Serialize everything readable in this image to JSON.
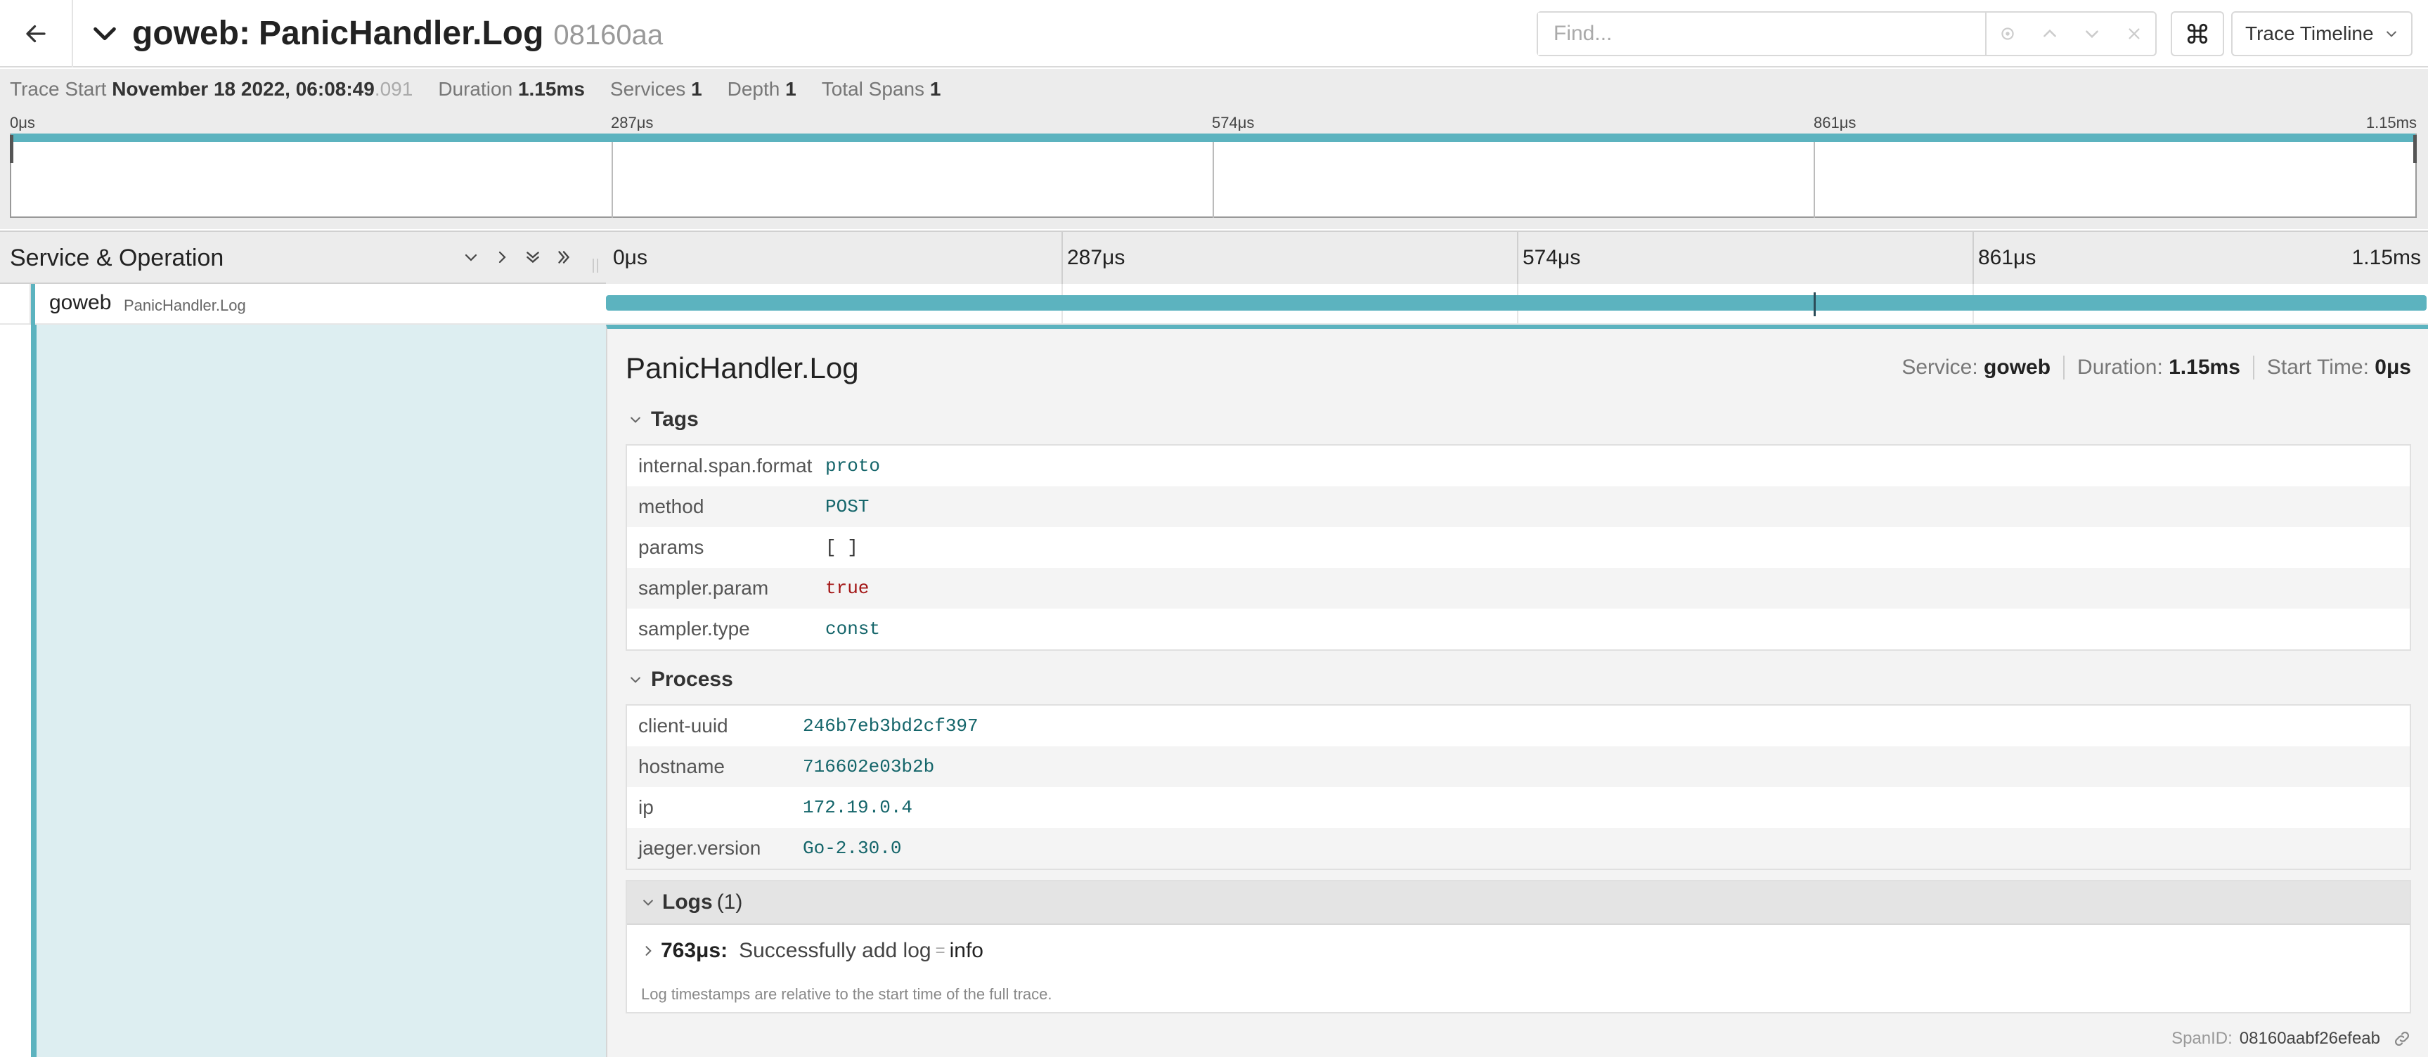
{
  "header": {
    "service": "goweb:",
    "operation": "PanicHandler.Log",
    "trace_id_short": "08160aa",
    "find_placeholder": "Find...",
    "view_label": "Trace Timeline"
  },
  "summary": {
    "trace_start_label": "Trace Start",
    "trace_start_value": "November 18 2022, 06:08:49",
    "trace_start_ms": ".091",
    "duration_label": "Duration",
    "duration_value": "1.15ms",
    "services_label": "Services",
    "services_value": "1",
    "depth_label": "Depth",
    "depth_value": "1",
    "total_spans_label": "Total Spans",
    "total_spans_value": "1"
  },
  "ticks": [
    "0μs",
    "287μs",
    "574μs",
    "861μs",
    "1.15ms"
  ],
  "timeline_header": {
    "title": "Service & Operation"
  },
  "span": {
    "service": "goweb",
    "operation": "PanicHandler.Log",
    "duration_fraction": 1.0,
    "log_offset_fraction": 0.663
  },
  "detail": {
    "title": "PanicHandler.Log",
    "service_label": "Service:",
    "service_value": "goweb",
    "duration_label": "Duration:",
    "duration_value": "1.15ms",
    "start_label": "Start Time:",
    "start_value": "0μs",
    "tags_title": "Tags",
    "tags": [
      {
        "key": "internal.span.format",
        "value": "proto",
        "type": "str"
      },
      {
        "key": "method",
        "value": "POST",
        "type": "str"
      },
      {
        "key": "params",
        "value": "[ ]",
        "type": "arr"
      },
      {
        "key": "sampler.param",
        "value": "true",
        "type": "bool"
      },
      {
        "key": "sampler.type",
        "value": "const",
        "type": "str"
      }
    ],
    "process_title": "Process",
    "process": [
      {
        "key": "client-uuid",
        "value": "246b7eb3bd2cf397"
      },
      {
        "key": "hostname",
        "value": "716602e03b2b"
      },
      {
        "key": "ip",
        "value": "172.19.0.4"
      },
      {
        "key": "jaeger.version",
        "value": "Go-2.30.0"
      }
    ],
    "logs_title": "Logs",
    "logs_count": "(1)",
    "log_entry": {
      "time": "763μs:",
      "message": "Successfully add log",
      "eq": "=",
      "level": "info"
    },
    "logs_note": "Log timestamps are relative to the start time of the full trace.",
    "span_id_label": "SpanID:",
    "span_id_value": "08160aabf26efeab"
  },
  "colors": {
    "accent": "#5cb3bf",
    "accent_light": "#ddeef1",
    "tag_string": "#14656a",
    "tag_bool": "#a31515"
  },
  "icons": [
    "back-arrow-icon",
    "chevron-down-icon",
    "target-icon",
    "chevron-up-icon",
    "close-icon",
    "command-key-icon",
    "chevron-right-icon",
    "double-chevron-down-icon",
    "double-chevron-right-icon",
    "link-icon"
  ]
}
